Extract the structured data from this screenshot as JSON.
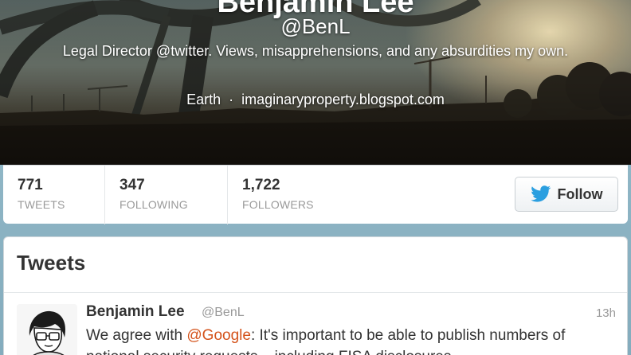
{
  "profile": {
    "name": "Benjamin Lee",
    "handle": "@BenL",
    "bio": "Legal Director @twitter. Views, misapprehensions, and any absurdities my own.",
    "location": "Earth",
    "separator": "·",
    "website": "imaginaryproperty.blogspot.com"
  },
  "stats": [
    {
      "value": "771",
      "label": "TWEETS"
    },
    {
      "value": "347",
      "label": "FOLLOWING"
    },
    {
      "value": "1,722",
      "label": "FOLLOWERS"
    }
  ],
  "follow_button": {
    "label": "Follow",
    "icon": "twitter-bird-icon",
    "icon_color": "#2b9fe0"
  },
  "tweets": {
    "heading": "Tweets",
    "items": [
      {
        "author": "Benjamin Lee",
        "handle": "@BenL",
        "time": "13h",
        "text_before": "We agree with ",
        "mention": "@Google",
        "text_after": ": It's important to be able to publish numbers of national security requests – including FISA disclosures"
      }
    ]
  },
  "colors": {
    "mention": "#d4531b",
    "stat_label": "#999999",
    "background": "#8db4c4"
  }
}
